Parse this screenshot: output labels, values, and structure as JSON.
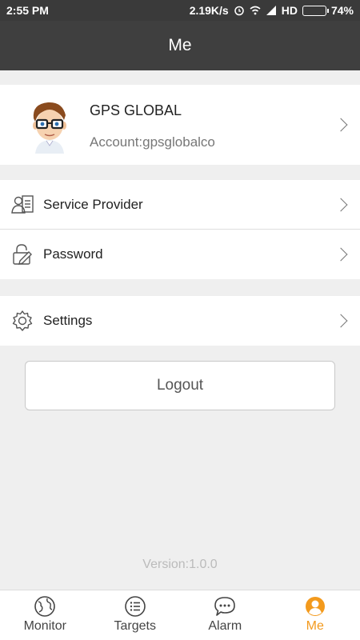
{
  "status_bar": {
    "time": "2:55 PM",
    "net_speed": "2.19K/s",
    "network": "HD",
    "battery": "74%",
    "battery_level": 0.74
  },
  "header": {
    "title": "Me"
  },
  "profile": {
    "name": "GPS GLOBAL",
    "account": "Account:gpsglobalco"
  },
  "menu": {
    "service_provider": "Service Provider",
    "password": "Password",
    "settings": "Settings"
  },
  "logout_label": "Logout",
  "version": "Version:1.0.0",
  "tabs": [
    {
      "label": "Monitor",
      "icon": "globe-icon"
    },
    {
      "label": "Targets",
      "icon": "list-icon"
    },
    {
      "label": "Alarm",
      "icon": "chat-icon"
    },
    {
      "label": "Me",
      "icon": "person-icon",
      "active": true
    }
  ],
  "colors": {
    "accent": "#f39a1d",
    "header_bg": "#3f3f3f"
  }
}
